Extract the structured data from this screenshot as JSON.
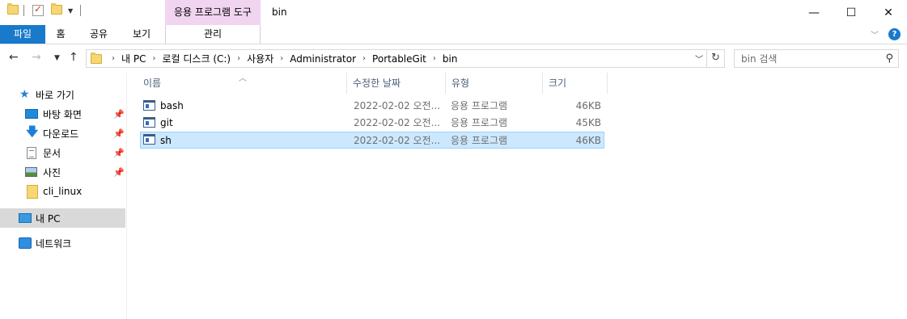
{
  "window": {
    "title": "bin",
    "contextual_group": "응용 프로그램 도구",
    "controls": {
      "minimize": "—",
      "maximize": "☐",
      "close": "✕"
    }
  },
  "ribbon": {
    "tabs": [
      {
        "label": "파일"
      },
      {
        "label": "홈"
      },
      {
        "label": "공유"
      },
      {
        "label": "보기"
      },
      {
        "label": "관리"
      }
    ],
    "help": "?"
  },
  "address": {
    "crumbs": [
      "내 PC",
      "로컬 디스크 (C:)",
      "사용자",
      "Administrator",
      "PortableGit",
      "bin"
    ]
  },
  "search": {
    "placeholder": "bin 검색"
  },
  "nav": {
    "items": [
      {
        "label": "바로 가기",
        "icon": "star-icon"
      },
      {
        "label": "바탕 화면",
        "icon": "desktop-icon",
        "pinned": true
      },
      {
        "label": "다운로드",
        "icon": "download-icon",
        "pinned": true
      },
      {
        "label": "문서",
        "icon": "document-icon",
        "pinned": true
      },
      {
        "label": "사진",
        "icon": "pictures-icon",
        "pinned": true
      },
      {
        "label": "cli_linux",
        "icon": "folder-icon"
      },
      {
        "label": "내 PC",
        "icon": "pc-icon",
        "selected": true
      },
      {
        "label": "네트워크",
        "icon": "network-icon"
      }
    ]
  },
  "columns": {
    "name": "이름",
    "modified": "수정한 날짜",
    "type": "유형",
    "size": "크기"
  },
  "files": [
    {
      "name": "bash",
      "modified": "2022-02-02 오전...",
      "type": "응용 프로그램",
      "size": "46KB"
    },
    {
      "name": "git",
      "modified": "2022-02-02 오전...",
      "type": "응용 프로그램",
      "size": "45KB"
    },
    {
      "name": "sh",
      "modified": "2022-02-02 오전...",
      "type": "응용 프로그램",
      "size": "46KB",
      "selected": true
    }
  ]
}
